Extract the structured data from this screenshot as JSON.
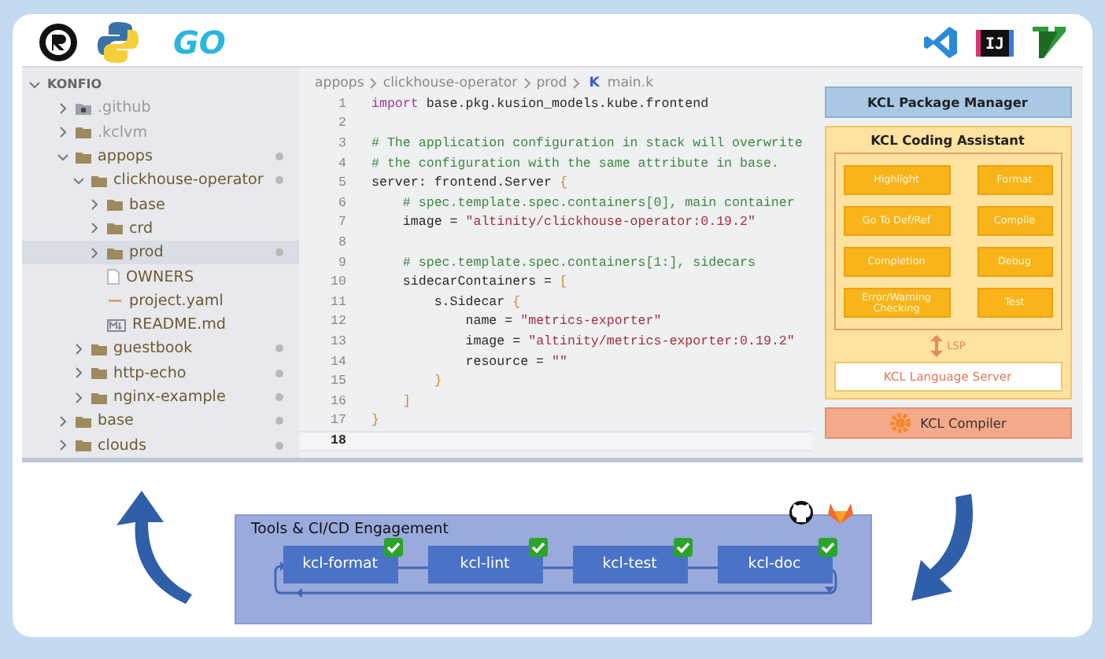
{
  "logos_left": [
    {
      "kind": "rust"
    },
    {
      "kind": "python"
    },
    {
      "kind": "go",
      "text": "GO"
    }
  ],
  "logos_right": [
    {
      "kind": "vscode"
    },
    {
      "kind": "intellij",
      "text": "IJ"
    },
    {
      "kind": "vim"
    }
  ],
  "explorer": {
    "root": "KONFIO",
    "expanded": true,
    "items": [
      {
        "name": ".github",
        "kind": "github-folder",
        "expanded": false,
        "dimmed": true,
        "modified": false,
        "selected": false
      },
      {
        "name": ".kclvm",
        "kind": "folder",
        "expanded": false,
        "dimmed": true,
        "modified": false,
        "selected": false
      },
      {
        "name": "appops",
        "kind": "folder",
        "expanded": true,
        "dimmed": false,
        "modified": true,
        "selected": false,
        "children": [
          {
            "name": "clickhouse-operator",
            "kind": "folder",
            "expanded": true,
            "dimmed": false,
            "modified": true,
            "selected": false,
            "children": [
              {
                "name": "base",
                "kind": "folder",
                "expanded": false,
                "dimmed": false,
                "modified": false,
                "selected": false
              },
              {
                "name": "crd",
                "kind": "folder",
                "expanded": false,
                "dimmed": false,
                "modified": false,
                "selected": false
              },
              {
                "name": "prod",
                "kind": "folder",
                "expanded": false,
                "dimmed": false,
                "modified": true,
                "selected": true
              },
              {
                "name": "OWNERS",
                "kind": "file",
                "dimmed": false,
                "modified": false,
                "selected": false
              },
              {
                "name": "project.yaml",
                "kind": "yaml",
                "dimmed": false,
                "modified": false,
                "selected": false
              },
              {
                "name": "README.md",
                "kind": "markdown",
                "dimmed": false,
                "modified": false,
                "selected": false
              }
            ]
          },
          {
            "name": "guestbook",
            "kind": "folder",
            "expanded": false,
            "dimmed": false,
            "modified": true,
            "selected": false
          },
          {
            "name": "http-echo",
            "kind": "folder",
            "expanded": false,
            "dimmed": false,
            "modified": true,
            "selected": false
          },
          {
            "name": "nginx-example",
            "kind": "folder",
            "expanded": false,
            "dimmed": false,
            "modified": true,
            "selected": false
          }
        ]
      },
      {
        "name": "base",
        "kind": "folder",
        "expanded": false,
        "dimmed": false,
        "modified": true,
        "selected": false
      },
      {
        "name": "clouds",
        "kind": "folder",
        "expanded": false,
        "dimmed": false,
        "modified": true,
        "selected": false
      }
    ]
  },
  "editor": {
    "breadcrumb": [
      "appops",
      "clickhouse-operator",
      "prod"
    ],
    "file_icon": "K",
    "file": "main.k",
    "lines": [
      {
        "no": "1",
        "current": false,
        "tokens": [
          {
            "kind": "kw",
            "text": "import"
          },
          {
            "kind": "plain",
            "text": " base.pkg.kusion_models.kube.frontend"
          }
        ]
      },
      {
        "no": "2",
        "current": false
      },
      {
        "no": "3",
        "current": false,
        "tokens": [
          {
            "kind": "comment",
            "text": "# The application configuration in stack will overwrite"
          }
        ]
      },
      {
        "no": "4",
        "current": false,
        "tokens": [
          {
            "kind": "comment",
            "text": "# the configuration with the same attribute in base."
          }
        ]
      },
      {
        "no": "5",
        "current": false,
        "tokens": [
          {
            "kind": "plain",
            "text": "server: frontend.Server "
          },
          {
            "kind": "bracket",
            "text": "{"
          }
        ]
      },
      {
        "no": "6",
        "current": false,
        "tokens": [
          {
            "kind": "comment",
            "text": "    # spec.template.spec.containers[0], main container"
          }
        ]
      },
      {
        "no": "7",
        "current": false,
        "tokens": [
          {
            "kind": "plain",
            "text": "    image = "
          },
          {
            "kind": "string",
            "text": "\"altinity/clickhouse-operator:0.19.2\""
          }
        ]
      },
      {
        "no": "8",
        "current": false
      },
      {
        "no": "9",
        "current": false,
        "tokens": [
          {
            "kind": "comment",
            "text": "    # spec.template.spec.containers[1:], sidecars"
          }
        ]
      },
      {
        "no": "10",
        "current": false,
        "tokens": [
          {
            "kind": "plain",
            "text": "    sidecarContainers = "
          },
          {
            "kind": "bracket",
            "text": "["
          }
        ]
      },
      {
        "no": "11",
        "current": false,
        "tokens": [
          {
            "kind": "plain",
            "text": "        s.Sidecar "
          },
          {
            "kind": "bracket",
            "text": "{"
          }
        ]
      },
      {
        "no": "12",
        "current": false,
        "tokens": [
          {
            "kind": "plain",
            "text": "            name = "
          },
          {
            "kind": "string",
            "text": "\"metrics-exporter\""
          }
        ]
      },
      {
        "no": "13",
        "current": false,
        "tokens": [
          {
            "kind": "plain",
            "text": "            image = "
          },
          {
            "kind": "string",
            "text": "\"altinity/metrics-exporter:0.19.2\""
          }
        ]
      },
      {
        "no": "14",
        "current": false,
        "tokens": [
          {
            "kind": "plain",
            "text": "            resource = "
          },
          {
            "kind": "string",
            "text": "\"\""
          }
        ]
      },
      {
        "no": "15",
        "current": false,
        "tokens": [
          {
            "kind": "bracket",
            "text": "        }"
          }
        ]
      },
      {
        "no": "16",
        "current": false,
        "tokens": [
          {
            "kind": "bracket",
            "text": "    ]"
          }
        ]
      },
      {
        "no": "17",
        "current": false,
        "tokens": [
          {
            "kind": "bracket",
            "text": "}"
          }
        ]
      },
      {
        "no": "18",
        "current": true
      }
    ]
  },
  "architecture": {
    "package_manager": "KCL Package Manager",
    "assistant": {
      "title": "KCL Coding Assistant",
      "left": [
        "Highlight",
        "Go To Def/Ref",
        "Completion",
        "Error/Warning Checking"
      ],
      "right": [
        "Format",
        "Compile",
        "Debug",
        "Test"
      ]
    },
    "protocol": "LSP",
    "language_server": "KCL Language Server",
    "compiler": "KCL Compiler"
  },
  "cicd": {
    "title": "Tools & CI/CD Engagement",
    "steps": [
      {
        "label": "kcl-format",
        "checked": true
      },
      {
        "label": "kcl-lint",
        "checked": true
      },
      {
        "label": "kcl-test",
        "checked": true
      },
      {
        "label": "kcl-doc",
        "checked": true
      }
    ]
  }
}
